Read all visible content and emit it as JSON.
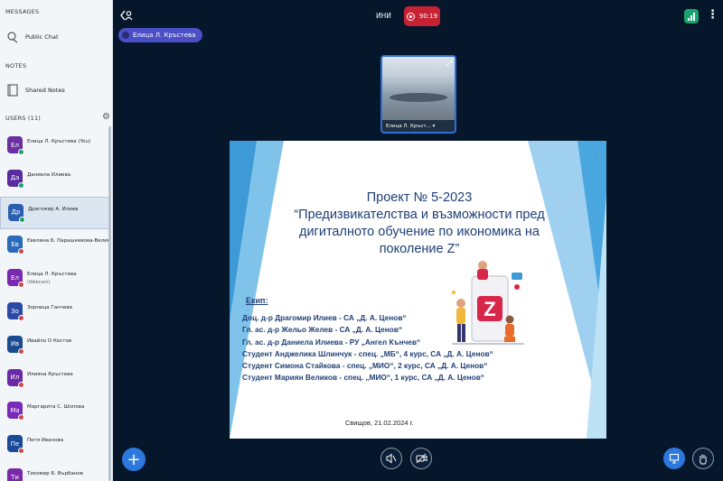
{
  "sidebar": {
    "messages_title": "MESSAGES",
    "public_chat": "Public Chat",
    "notes_title": "NOTES",
    "shared_notes": "Shared Notes",
    "users_title": "USERS (11)",
    "users": [
      {
        "initials": "Ел",
        "name": "Елица Л. Кръстева (You)",
        "color": "#6a2fa0",
        "sub": ""
      },
      {
        "initials": "Да",
        "name": "Даниела Илиева",
        "color": "#5a2aa0",
        "sub": ""
      },
      {
        "initials": "Др",
        "name": "Драгомир А. Илиев",
        "color": "#2a5fb0",
        "sub": ""
      },
      {
        "initials": "Ев",
        "name": "Евелина Б. Парашкевова-Велик...",
        "color": "#2a6ab8",
        "sub": ""
      },
      {
        "initials": "Ел",
        "name": "Елица Л. Кръстева",
        "color": "#7a2ab0",
        "sub": "(Webcam)"
      },
      {
        "initials": "Зо",
        "name": "Зорница Ганчева",
        "color": "#2a4aa8",
        "sub": ""
      },
      {
        "initials": "Ив",
        "name": "Ивайло О Костов",
        "color": "#1a4a90",
        "sub": ""
      },
      {
        "initials": "Ил",
        "name": "Илияна Кръстева",
        "color": "#6a2aa8",
        "sub": ""
      },
      {
        "initials": "Ма",
        "name": "Маргарита С. Шопова",
        "color": "#7a2ab8",
        "sub": ""
      },
      {
        "initials": "Пе",
        "name": "Петя Иванова",
        "color": "#1a4a98",
        "sub": ""
      },
      {
        "initials": "Ти",
        "name": "Тихомир Б. Върбанов",
        "color": "#7a2aa8",
        "sub": ""
      }
    ]
  },
  "header": {
    "presenter": "Елица Л. Кръстева",
    "meeting_title": "ИНИ",
    "recording_time": "90:19"
  },
  "webcam": {
    "caption": "Елица Л. Кръст..."
  },
  "slide": {
    "title_lines": [
      "Проект № 5-2023",
      "“Предизвикателства и възможности пред",
      "дигиталното обучение по икономика на",
      "поколение Z”"
    ],
    "team_label": "Екип:",
    "team": [
      "Доц. д-р Драгомир Илиев - СА „Д. А. Ценов“",
      "Гл. ас. д-р Жельо Желев - СА „Д. А. Ценов“",
      "Гл. ас. д-р Даниела Илиева - РУ „Ангел Кънчев“",
      "Студент Анджелика Шлинчук - спец. „МБ“, 4 курс, СА „Д. А. Ценов“",
      "Студент Симона Стайкова - спец. „МИО“, 2 курс, СА „Д. А. Ценов“",
      "Студент Мариян Великов - спец. „МИО“, 1 курс, СА „Д. А. Ценов“"
    ],
    "footer": "Свищов, 21.02.2024 г.",
    "illustration_letter": "Z"
  },
  "colors": {
    "accent": "#2c78dd",
    "record": "#c62233",
    "background": "#06172c",
    "connection": "#1aa36f"
  }
}
